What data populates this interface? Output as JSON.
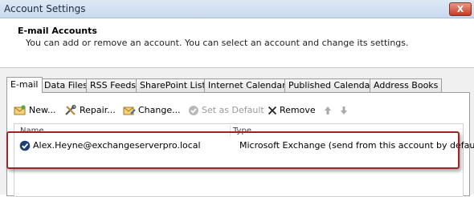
{
  "window": {
    "title": "Account Settings",
    "close_label": "X"
  },
  "header": {
    "heading": "E-mail Accounts",
    "description": "You can add or remove an account. You can select an account and change its settings."
  },
  "tabs": [
    {
      "label": "E-mail",
      "active": true
    },
    {
      "label": "Data Files"
    },
    {
      "label": "RSS Feeds"
    },
    {
      "label": "SharePoint Lists"
    },
    {
      "label": "Internet Calendars"
    },
    {
      "label": "Published Calendars"
    },
    {
      "label": "Address Books"
    }
  ],
  "toolbar": {
    "new": "New...",
    "repair": "Repair...",
    "change": "Change...",
    "set_default": "Set as Default",
    "remove": "Remove"
  },
  "list": {
    "columns": [
      "Name",
      "Type"
    ],
    "rows": [
      {
        "name": "Alex.Heyne@exchangeserverpro.local",
        "type": "Microsoft Exchange (send from this account by default)"
      }
    ]
  },
  "colors": {
    "title_bar": "#c9d9ee",
    "highlight": "#a1232a",
    "default_check": "#1f3f6e"
  }
}
